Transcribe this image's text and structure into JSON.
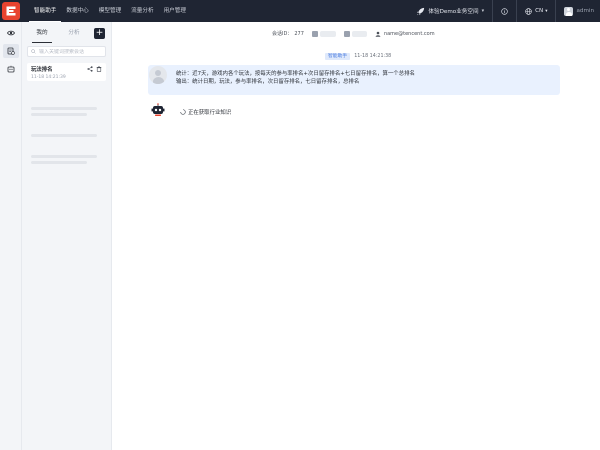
{
  "topbar": {
    "nav": [
      {
        "label": "智能助手",
        "active": true
      },
      {
        "label": "数据中心",
        "active": false
      },
      {
        "label": "模型管理",
        "active": false
      },
      {
        "label": "流量分析",
        "active": false
      },
      {
        "label": "用户管理",
        "active": false
      }
    ],
    "workspace": "体验Demo业务空间",
    "language": "CN",
    "user": "admin"
  },
  "sessions": {
    "tabs": [
      "我的",
      "分析"
    ],
    "search_placeholder": "输入关键词搜索会话",
    "items": [
      {
        "title": "玩法排名",
        "time": "11-18 14:21:39"
      }
    ]
  },
  "chat": {
    "session_label": "会话ID：",
    "session_id": "277",
    "user_email": "name@tencent.com",
    "sender_name": "智能助手",
    "message_time": "11-18 14:21:38",
    "user_message_line1": "统计：近7天，游戏内各个玩法，按每天的参与率排名+次日留存排名+七日留存排名，算一个总排名",
    "user_message_line2": "输出：统计日期，玩法，参与率排名，次日留存排名，七日留存排名，总排名",
    "bot_status": "正在获取行业知识"
  },
  "colors": {
    "topbar": "#1f2533",
    "brand": "#e8432f",
    "user_bubble": "#e9f1fe",
    "accent": "#4a7ce0"
  }
}
